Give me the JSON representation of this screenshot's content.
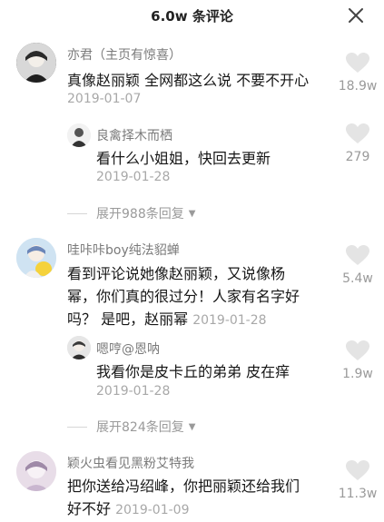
{
  "header": {
    "title": "6.0w 条评论",
    "close_icon": "close-icon"
  },
  "comments": [
    {
      "user": "亦君（主页有惊喜）",
      "text": "真像赵丽颖 全网都这么说 不要不开心",
      "date": "2019-01-07",
      "likes": "18.9w",
      "reply": {
        "user": "良禽择木而栖",
        "text": "看什么小姐姐，快回去更新",
        "date": "2019-01-28",
        "likes": "279"
      },
      "expand": "展开988条回复"
    },
    {
      "user": "哇咔咔boy纯法貂蝉",
      "text_lines": [
        "看到评论说她像赵丽颖，又说像杨",
        "幂，你们真的很过分！人家有名字好",
        "吗？ 是吧，赵丽幂"
      ],
      "date": "2019-01-28",
      "likes": "5.4w",
      "reply": {
        "user": "嗯哼@恩呐",
        "text": "我看你是皮卡丘的弟弟 皮在痒",
        "date": "2019-01-28",
        "likes": "1.9w"
      },
      "expand": "展开824条回复"
    },
    {
      "user": "颖火虫看见黑粉艾特我",
      "text_lines": [
        "把你送给冯绍峰，你把丽颖还给我们",
        "好不好"
      ],
      "date": "2019-01-09",
      "likes": "11.3w"
    }
  ],
  "colors": {
    "username": "#7a7a7a",
    "text": "#161616",
    "meta": "#a8a8a8",
    "heart": "#e4e4e4"
  }
}
